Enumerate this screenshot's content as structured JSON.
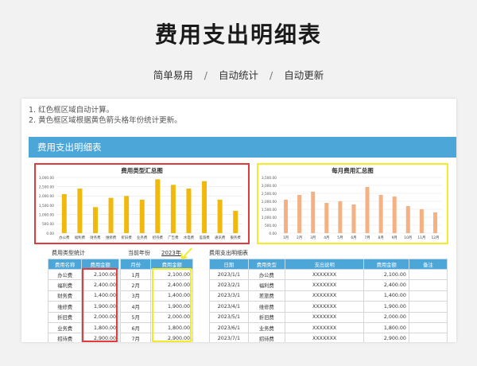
{
  "header": {
    "title": "费用支出明细表",
    "subtitles": [
      "简单易用",
      "自动统计",
      "自动更新"
    ],
    "separator": "/"
  },
  "notes": [
    "1. 红色框区域自动计算。",
    "2. 黄色框区域根据黄色箭头格年份统计更新。"
  ],
  "banner": "费用支出明细表",
  "colors": {
    "accent": "#4da6d8",
    "bar_category": "#f0b90b",
    "bar_month": "#f4b183",
    "red_box": "#e23b3b",
    "yellow_box": "#f3ea2a"
  },
  "labels": {
    "type_stats": "费用类型统计",
    "current_year": "当前年份",
    "current_year_value": "2023年",
    "detail": "费用支出明细表"
  },
  "type_table": {
    "headers": [
      "费用名称",
      "费用金额"
    ],
    "rows": [
      [
        "办公费",
        "2,100.00"
      ],
      [
        "福利费",
        "2,400.00"
      ],
      [
        "财务费",
        "1,400.00"
      ],
      [
        "维修费",
        "1,900.00"
      ],
      [
        "折旧费",
        "2,000.00"
      ],
      [
        "业务费",
        "1,800.00"
      ],
      [
        "招待费",
        "2,900.00"
      ]
    ]
  },
  "month_table": {
    "headers": [
      "月份",
      "费用金额"
    ],
    "rows": [
      [
        "1月",
        "2,100.00"
      ],
      [
        "2月",
        "2,400.00"
      ],
      [
        "3月",
        "1,400.00"
      ],
      [
        "4月",
        "1,900.00"
      ],
      [
        "5月",
        "2,000.00"
      ],
      [
        "6月",
        "1,800.00"
      ],
      [
        "7月",
        "2,900.00"
      ]
    ]
  },
  "detail_table": {
    "headers": [
      "日期",
      "费用类型",
      "支出说明",
      "费用金额",
      "备注"
    ],
    "rows": [
      [
        "2023/1/1",
        "办公费",
        "XXXXXXX",
        "2,100.00",
        ""
      ],
      [
        "2023/2/1",
        "福利费",
        "XXXXXXX",
        "2,400.00",
        ""
      ],
      [
        "2023/3/1",
        "差旅费",
        "XXXXXXX",
        "1,400.00",
        ""
      ],
      [
        "2023/4/1",
        "维修费",
        "XXXXXXX",
        "1,900.00",
        ""
      ],
      [
        "2023/5/1",
        "折旧费",
        "XXXXXXX",
        "2,000.00",
        ""
      ],
      [
        "2023/6/1",
        "业务费",
        "XXXXXXX",
        "1,800.00",
        ""
      ],
      [
        "2023/7/1",
        "招待费",
        "XXXXXXX",
        "2,900.00",
        ""
      ]
    ]
  },
  "chart_data": [
    {
      "type": "bar",
      "title": "费用类型汇总图",
      "categories": [
        "办公费",
        "福利费",
        "财务费",
        "维修费",
        "折旧费",
        "业务费",
        "招待费",
        "广告费",
        "水电费",
        "差旅费",
        "通讯费",
        "服务费"
      ],
      "values": [
        2100,
        2400,
        1400,
        1900,
        2000,
        1800,
        2900,
        2600,
        2400,
        2800,
        1800,
        1200
      ],
      "yticks": [
        "0.00",
        "500.00",
        "1,000.00",
        "1,500.00",
        "2,000.00",
        "2,500.00",
        "3,000.00"
      ],
      "ylim": [
        0,
        3000
      ]
    },
    {
      "type": "bar",
      "title": "每月费用汇总图",
      "categories": [
        "1月",
        "2月",
        "3月",
        "4月",
        "5月",
        "6月",
        "7月",
        "8月",
        "9月",
        "10月",
        "11月",
        "12月"
      ],
      "values": [
        2100,
        2400,
        2600,
        1900,
        2000,
        1800,
        2900,
        2400,
        2300,
        1700,
        1500,
        1300
      ],
      "yticks": [
        "0.00",
        "500.00",
        "1,000.00",
        "1,500.00",
        "2,000.00",
        "2,500.00",
        "3,000.00",
        "3,500.00"
      ],
      "ylim": [
        0,
        3500
      ]
    }
  ]
}
